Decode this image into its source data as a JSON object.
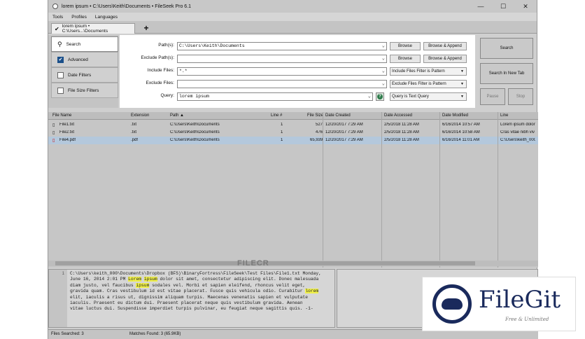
{
  "window": {
    "title": "lorem ipsum • C:\\Users\\Keith\\Documents • FileSeek Pro 6.1",
    "controls": [
      "—",
      "☐",
      "✕"
    ]
  },
  "menu": [
    "Tools",
    "Profiles",
    "Languages"
  ],
  "tabs": [
    {
      "label": "lorem ipsum • C:\\Users...\\Documents"
    }
  ],
  "add_tab": "+",
  "sidebar": {
    "items": [
      {
        "label": "Search",
        "icon": "search-icon"
      },
      {
        "label": "Advanced",
        "checked": true
      },
      {
        "label": "Date Filters",
        "checked": false
      },
      {
        "label": "File Size Filters",
        "checked": false
      }
    ]
  },
  "form": {
    "path_label": "Path(s):",
    "path_value": "C:\\Users\\Keith\\Documents",
    "exclude_path_label": "Exclude Path(s):",
    "exclude_path_value": "",
    "include_files_label": "Include Files:",
    "include_files_value": "*.*",
    "exclude_files_label": "Exclude Files:",
    "exclude_files_value": "",
    "query_label": "Query:",
    "query_value": "lorem ipsum",
    "browse": "Browse",
    "browse_append": "Browse & Append",
    "include_filter_mode": "Include Files Filter is Pattern",
    "exclude_filter_mode": "Exclude Files Filter is Pattern",
    "query_mode": "Query is Text Query",
    "help": "?"
  },
  "actions": {
    "search": "Search",
    "search_new_tab": "Search In New Tab",
    "pause": "Pause",
    "stop": "Stop"
  },
  "results": {
    "columns": [
      "File Name",
      "Extension",
      "Path ▲",
      "Line #",
      "File Size",
      "Date Created",
      "Date Accessed",
      "Date Modified",
      "Line"
    ],
    "rows": [
      {
        "name": "File1.txt",
        "ext": ".txt",
        "path": "C:\\Users\\Keith\\Documents",
        "line": "1",
        "size": "527",
        "created": "12/20/2017 7:29 AM",
        "accessed": "2/5/2018 11:28 AM",
        "modified": "6/16/2014 10:57 AM",
        "text": "Lorem ipsum dolor"
      },
      {
        "name": "File2.txt",
        "ext": ".txt",
        "path": "C:\\Users\\Keith\\Documents",
        "line": "1",
        "size": "476",
        "created": "12/20/2017 7:29 AM",
        "accessed": "2/5/2018 11:28 AM",
        "modified": "6/16/2014 10:58 AM",
        "text": "Cras vitae nibh viv"
      },
      {
        "name": "File4.pdf",
        "ext": ".pdf",
        "path": "C:\\Users\\Keith\\Documents",
        "line": "1",
        "size": "65,939",
        "created": "12/20/2017 7:29 AM",
        "accessed": "2/5/2018 11:28 AM",
        "modified": "6/16/2014 11:01 AM",
        "text": "C:\\Users\\keith_000"
      }
    ]
  },
  "preview": {
    "gutter": "1",
    "line1_pre": "C:\\Users\\keith_000\\Documents\\Dropbox (BFS)\\BinaryFortress\\FileSeek\\Test Files\\File1.txt Monday,",
    "line2_pre": "June 16, 2014 2:01 PM ",
    "hl1": "Lorem",
    "sp1": " ",
    "hl2": "ipsum",
    "line2_post": " dolor sit amet, consectetur adipiscing elit. Donec malesuada",
    "line3_pre": "diam justo, vel faucibus ",
    "hl3": "ipsum",
    "line3_post": " sodales vel. Morbi et sapien eleifend, rhoncus velit eget,",
    "line4": "gravida quam. Cras vestibulum id est vitae placerat. Fusce quis vehicula odio. Curabitur ",
    "hl4": "lorem",
    "line5": "elit, iaculis a risus ut, dignissim aliquam turpis. Maecenas venenatis sapien et vulputate",
    "line6": "iaculis. Praesent eu dictum dui. Praesent placerat neque quis vestibulum gravida. Aenean",
    "line7": "vitae luctus dui. Suspendisse imperdiet turpis pulvinar, eu feugiat neque sagittis quis. -1-"
  },
  "status": {
    "files_searched": "Files Searched: 3",
    "matches_found": "Matches Found: 3 (65.9KB)"
  },
  "watermark": {
    "filecr": "FILECR",
    "filegit": "FileGit",
    "filegit_sub": "Free & Unlimited"
  }
}
